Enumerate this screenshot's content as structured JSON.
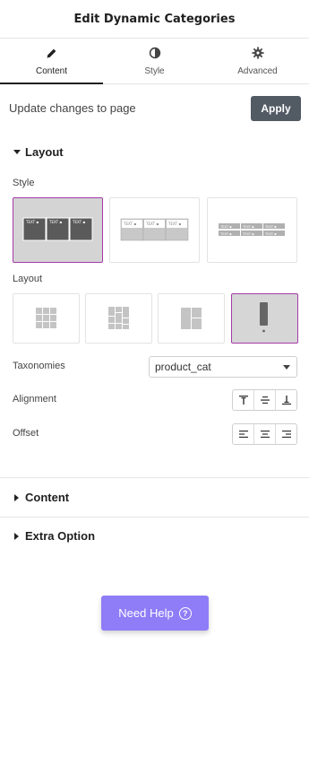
{
  "header": {
    "title": "Edit Dynamic Categories"
  },
  "tabs": [
    {
      "label": "Content",
      "icon": "pencil-icon",
      "active": true
    },
    {
      "label": "Style",
      "icon": "contrast-icon",
      "active": false
    },
    {
      "label": "Advanced",
      "icon": "gear-icon",
      "active": false
    }
  ],
  "update": {
    "text": "Update changes to page",
    "apply_label": "Apply"
  },
  "layout_section": {
    "title": "Layout",
    "style_label": "Style",
    "style_options": [
      {
        "name": "boxed-text",
        "selected": true,
        "thumb_text": "TEXT"
      },
      {
        "name": "card-grid",
        "selected": false,
        "thumb_text": "TEXT"
      },
      {
        "name": "tag-list",
        "selected": false,
        "thumb_text": "TEXT"
      }
    ],
    "layout_label": "Layout",
    "layout_options": [
      {
        "name": "grid",
        "selected": false
      },
      {
        "name": "masonry",
        "selected": false
      },
      {
        "name": "metro",
        "selected": false
      },
      {
        "name": "carousel",
        "selected": true
      }
    ],
    "taxonomies_label": "Taxonomies",
    "taxonomies_value": "product_cat",
    "alignment_label": "Alignment",
    "offset_label": "Offset"
  },
  "content_section": {
    "title": "Content"
  },
  "extra_section": {
    "title": "Extra Option"
  },
  "help": {
    "label": "Need Help",
    "icon_glyph": "?"
  },
  "colors": {
    "accent": "#8f7cf7",
    "selected_border": "#a63aa8",
    "apply_bg": "#525a64"
  }
}
